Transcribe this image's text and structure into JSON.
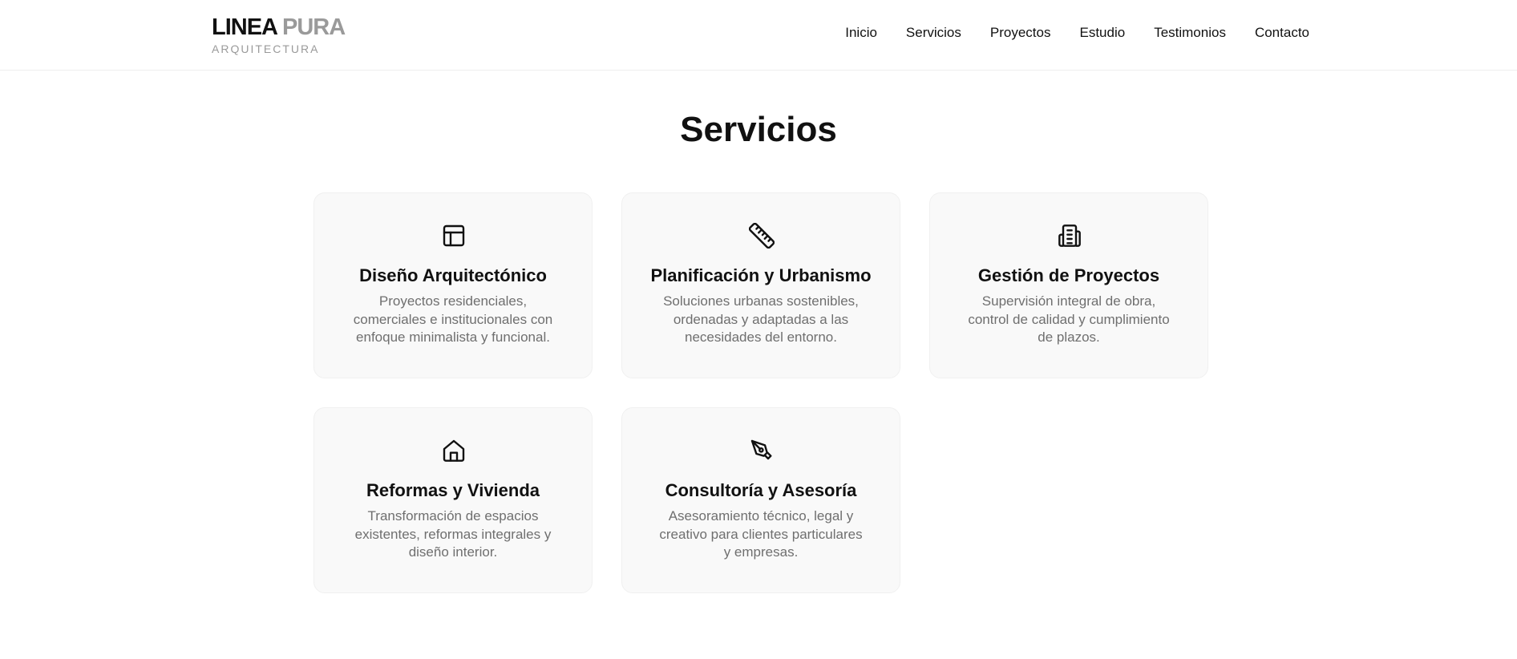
{
  "header": {
    "logo_strong": "LINEA",
    "logo_light": "PURA",
    "logo_sub": "ARQUITECTURA",
    "nav": [
      "Inicio",
      "Servicios",
      "Proyectos",
      "Estudio",
      "Testimonios",
      "Contacto"
    ]
  },
  "services": {
    "title": "Servicios",
    "cards": [
      {
        "icon": "layout-icon",
        "title": "Diseño Arquitectónico",
        "description": "Proyectos residenciales, comerciales e institucionales con enfoque minimalista y funcional."
      },
      {
        "icon": "ruler-icon",
        "title": "Planificación y Urbanismo",
        "description": "Soluciones urbanas sostenibles, ordenadas y adaptadas a las necesidades del entorno."
      },
      {
        "icon": "building-icon",
        "title": "Gestión de Proyectos",
        "description": "Supervisión integral de obra, control de calidad y cumplimiento de plazos."
      },
      {
        "icon": "home-icon",
        "title": "Reformas y Vivienda",
        "description": "Transformación de espacios existentes, reformas integrales y diseño interior."
      },
      {
        "icon": "pen-tool-icon",
        "title": "Consultoría y Asesoría",
        "description": "Asesoramiento técnico, legal y creativo para clientes particulares y empresas."
      }
    ]
  },
  "colors": {
    "text": "#111111",
    "muted": "#6f6f6f",
    "logo_accent": "#9a9a9a",
    "card_bg": "#f9f9f9"
  }
}
